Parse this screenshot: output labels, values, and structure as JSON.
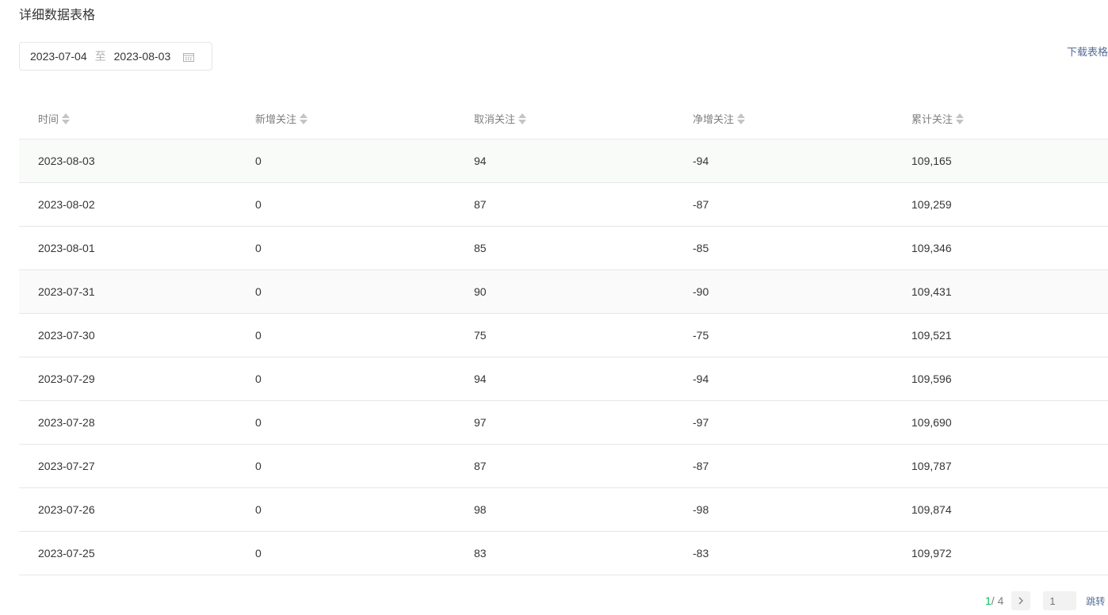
{
  "page_title": "详细数据表格",
  "date_range": {
    "start": "2023-07-04",
    "separator": "至",
    "end": "2023-08-03"
  },
  "download_label": "下载表格",
  "table": {
    "headers": [
      "时间",
      "新增关注",
      "取消关注",
      "净增关注",
      "累计关注"
    ],
    "rows": [
      [
        "2023-08-03",
        "0",
        "94",
        "-94",
        "109,165"
      ],
      [
        "2023-08-02",
        "0",
        "87",
        "-87",
        "109,259"
      ],
      [
        "2023-08-01",
        "0",
        "85",
        "-85",
        "109,346"
      ],
      [
        "2023-07-31",
        "0",
        "90",
        "-90",
        "109,431"
      ],
      [
        "2023-07-30",
        "0",
        "75",
        "-75",
        "109,521"
      ],
      [
        "2023-07-29",
        "0",
        "94",
        "-94",
        "109,596"
      ],
      [
        "2023-07-28",
        "0",
        "97",
        "-97",
        "109,690"
      ],
      [
        "2023-07-27",
        "0",
        "87",
        "-87",
        "109,787"
      ],
      [
        "2023-07-26",
        "0",
        "98",
        "-98",
        "109,874"
      ],
      [
        "2023-07-25",
        "0",
        "83",
        "-83",
        "109,972"
      ]
    ]
  },
  "pagination": {
    "current": "1",
    "total": "/ 4",
    "next_icon": "chevron-right-icon",
    "input_placeholder": "1",
    "jump_label": "跳转"
  },
  "colors": {
    "accent_green": "#07c160",
    "link_blue": "#576b95"
  }
}
